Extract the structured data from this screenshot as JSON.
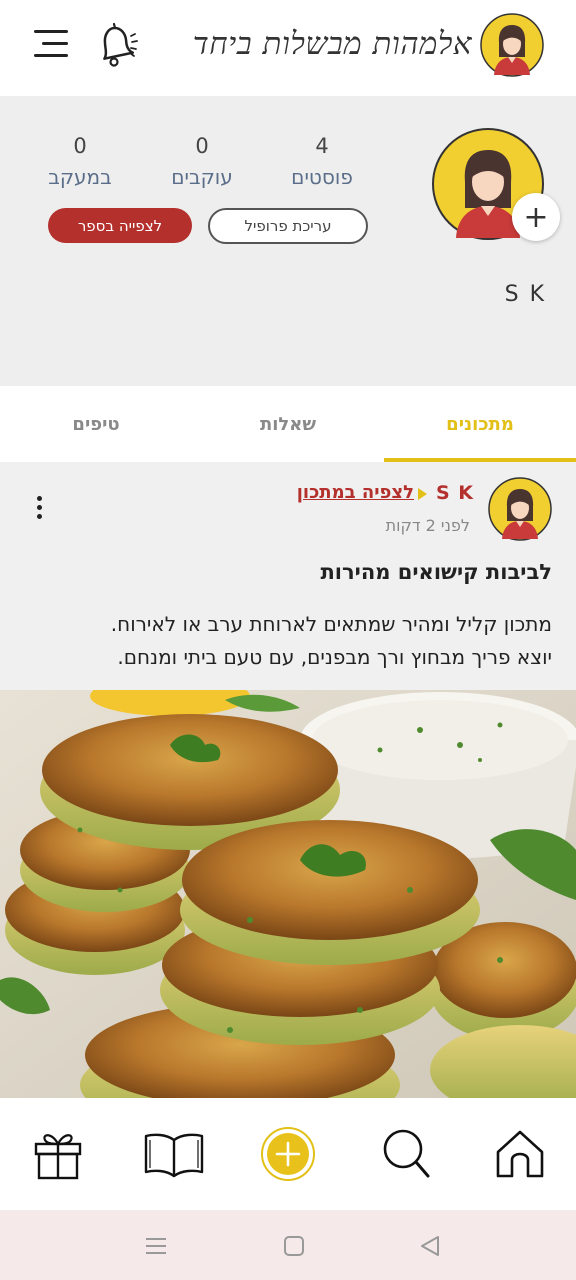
{
  "header": {
    "title": "אלמהות מבשלות ביחד",
    "menu_icon": "hamburger-menu-icon",
    "bell_icon": "bell-icon"
  },
  "profile": {
    "name": "S K",
    "stats": {
      "posts": {
        "value": "4",
        "label": "פוסטים"
      },
      "followers": {
        "value": "0",
        "label": "עוקבים"
      },
      "following": {
        "value": "0",
        "label": "במעקב"
      }
    },
    "edit_button": "עריכת פרופיל",
    "book_button": "לצפייה בספר",
    "add_photo_symbol": "+"
  },
  "tabs": [
    {
      "label": "מתכונים",
      "active": true
    },
    {
      "label": "שאלות",
      "active": false
    },
    {
      "label": "טיפים",
      "active": false
    }
  ],
  "post": {
    "user": "S K",
    "link": "לצפיה במתכון",
    "time": "לפני 2 דקות",
    "title": "לביבות קישואים מהירות",
    "description_line1": "מתכון קליל ומהיר שמתאים לארוחת ערב או לאירוח.",
    "description_line2": "יוצא פריך מבחוץ ורך מבפנים, עם טעם ביתי ומנחם."
  },
  "bottom_nav": {
    "items": [
      "home-icon",
      "search-icon",
      "add-icon",
      "book-icon",
      "gift-icon"
    ]
  },
  "colors": {
    "accent_yellow": "#e2c018",
    "brand_red": "#b3302c",
    "profile_bg": "#eeeeee",
    "system_bar_bg": "#f5e9e9"
  }
}
